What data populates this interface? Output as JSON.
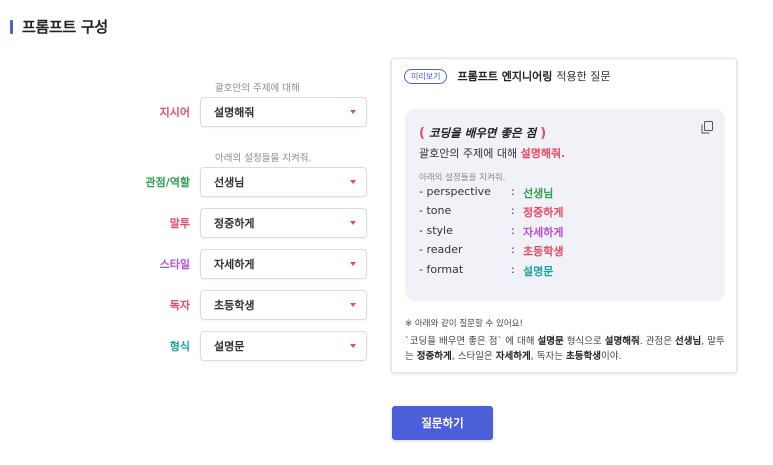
{
  "section": {
    "title": "프롬프트 구성"
  },
  "form": {
    "hint_topic": "괄호안의 주제에 대해",
    "hint_settings": "아래의 설정들을 지켜줘.",
    "rows": [
      {
        "label": "지시어",
        "value": "설명해줘",
        "label_color": "#e84a5f"
      },
      {
        "label": "관점/역할",
        "value": "선생님",
        "label_color": "#2e9e4f"
      },
      {
        "label": "말투",
        "value": "정중하게",
        "label_color": "#e84a5f"
      },
      {
        "label": "스타일",
        "value": "자세하게",
        "label_color": "#b84ed6"
      },
      {
        "label": "독자",
        "value": "초등학생",
        "label_color": "#e84a5f"
      },
      {
        "label": "형식",
        "value": "설명문",
        "label_color": "#1aa3a3"
      }
    ]
  },
  "preview": {
    "pill": "미리보기",
    "title_strong": "프롬프트 엔지니어링",
    "title_rest": "적용한 질문",
    "paren_open": "(",
    "paren_close": ")",
    "topic": "코딩을 배우면 좋은 점",
    "instruction_prefix": "괄호안의 주제에 대해 ",
    "instruction_accent": "설명해줘.",
    "settings_note": "아래의 설정들을 지켜줘.",
    "settings": [
      {
        "key": "- perspective",
        "sep": ":",
        "value": "선생님",
        "color": "#2e9e4f"
      },
      {
        "key": "- tone",
        "sep": ":",
        "value": "정중하게",
        "color": "#e84a5f"
      },
      {
        "key": "- style",
        "sep": ":",
        "value": "자세하게",
        "color": "#b84ed6"
      },
      {
        "key": "- reader",
        "sep": ":",
        "value": "초등학생",
        "color": "#e84a5f"
      },
      {
        "key": "- format",
        "sep": ":",
        "value": "설명문",
        "color": "#1aa3a3"
      }
    ],
    "note": "※ 아래와 같이 질문할 수 있어요!",
    "summary": {
      "p1": "`코딩을 배우면 좋은 점` 에 대해 ",
      "b1": "설명문",
      "p2": " 형식으로 ",
      "b2": "설명해줘",
      "p3": ". 관점은 ",
      "b3": "선생님",
      "p4": ", 말투는 ",
      "b4": "정중하게",
      "p5": ", 스타일은 ",
      "b5": "자세하게",
      "p6": ", 독자는 ",
      "b6": "초등학생",
      "p7": "이야."
    }
  },
  "actions": {
    "ask_label": "질문하기"
  },
  "icons": {
    "copy": "copy-icon",
    "dropdown": "chevron-down-icon"
  },
  "colors": {
    "accent": "#4b5fd9",
    "caret": "#e84a5f"
  }
}
